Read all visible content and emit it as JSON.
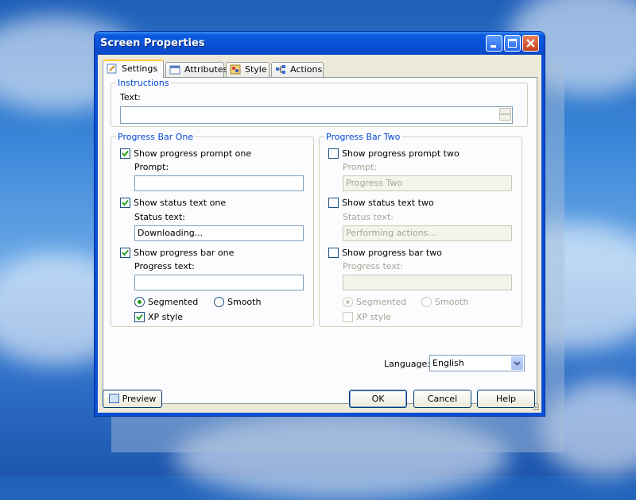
{
  "window": {
    "title": "Screen Properties"
  },
  "tabs": [
    {
      "label": "Settings",
      "icon": "pencil-note-icon",
      "active": true
    },
    {
      "label": "Attributes",
      "icon": "window-icon",
      "active": false
    },
    {
      "label": "Style",
      "icon": "palette-icon",
      "active": false
    },
    {
      "label": "Actions",
      "icon": "flow-icon",
      "active": false
    }
  ],
  "instructions": {
    "legend": "Instructions",
    "text_label": "Text:",
    "text_value": ""
  },
  "bar_one": {
    "legend": "Progress Bar One",
    "show_prompt": {
      "label": "Show progress prompt one",
      "checked": true
    },
    "prompt_label": "Prompt:",
    "prompt_value": "",
    "show_status": {
      "label": "Show status text one",
      "checked": true
    },
    "status_label": "Status text:",
    "status_value": "Downloading...",
    "show_bar": {
      "label": "Show progress bar one",
      "checked": true
    },
    "progress_label": "Progress text:",
    "progress_value": "",
    "segmented_label": "Segmented",
    "smooth_label": "Smooth",
    "xp_style": {
      "label": "XP style",
      "checked": true
    }
  },
  "bar_two": {
    "legend": "Progress Bar Two",
    "show_prompt": {
      "label": "Show progress prompt two",
      "checked": false
    },
    "prompt_label": "Prompt:",
    "prompt_value": "Progress Two",
    "show_status": {
      "label": "Show status text two",
      "checked": false
    },
    "status_label": "Status text:",
    "status_value": "Performing actions...",
    "show_bar": {
      "label": "Show progress bar two",
      "checked": false
    },
    "progress_label": "Progress text:",
    "progress_value": "",
    "segmented_label": "Segmented",
    "smooth_label": "Smooth",
    "xp_style": {
      "label": "XP style",
      "checked": false
    }
  },
  "language": {
    "label": "Language:",
    "value": "English"
  },
  "footer": {
    "preview_label": "Preview",
    "ok_label": "OK",
    "cancel_label": "Cancel",
    "help_label": "Help"
  },
  "colors": {
    "title_bar": "#0a4fd4",
    "dialog_bg": "#ece9d8",
    "group_legend": "#0046d5",
    "active_tab_accent": "#ffc83c"
  }
}
